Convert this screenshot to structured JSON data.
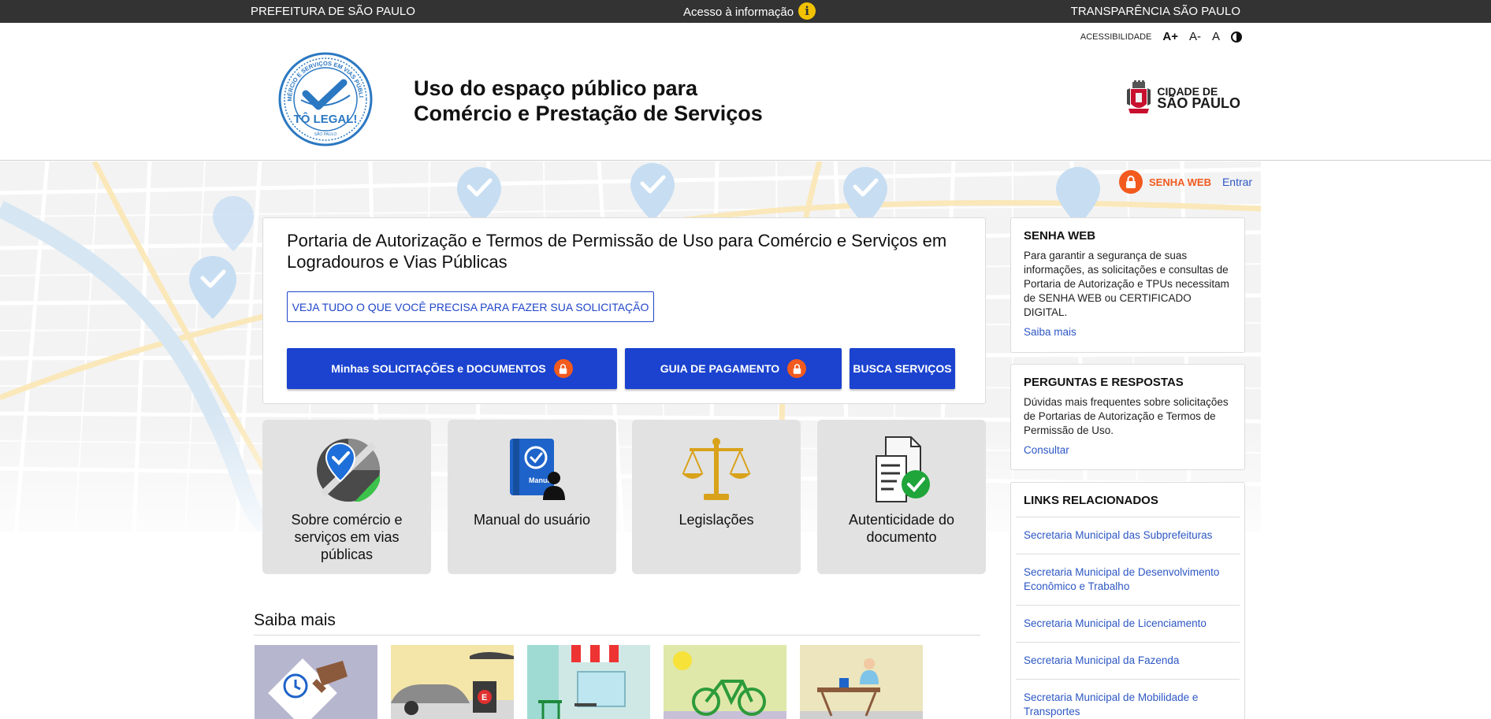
{
  "topbar": {
    "left": "PREFEITURA DE SÃO PAULO",
    "center": "Acesso à informação",
    "right": "TRANSPARÊNCIA SÃO PAULO"
  },
  "accessibility": {
    "label": "ACESSIBILIDADE",
    "increase": "A+",
    "decrease": "A-",
    "reset": "A"
  },
  "header": {
    "seal_text_top": "COMÉRCIO E SERVIÇOS EM VIAS PÚBLICAS",
    "seal_text_main": "TÔ LEGAL!",
    "seal_text_bottom": "SÃO PAULO",
    "title_line1": "Uso do espaço público para",
    "title_line2": "Comércio e Prestação de Serviços",
    "city_line1": "CIDADE DE",
    "city_line2": "SÃO PAULO"
  },
  "login": {
    "senha_label": "SENHA WEB",
    "entrar_label": "Entrar"
  },
  "main": {
    "heading": "Portaria de Autorização e Termos de Permissão de Uso para Comércio e Serviços em Logradouros e Vias Públicas",
    "outline_button": "VEJA TUDO O QUE VOCÊ PRECISA PARA FAZER SUA SOLICITAÇÃO",
    "btn_solicitacoes": "Minhas SOLICITAÇÕES e DOCUMENTOS",
    "btn_guia": "GUIA DE PAGAMENTO",
    "btn_busca": "BUSCA SERVIÇOS"
  },
  "tiles": [
    {
      "label": "Sobre comércio e serviços em vias públicas",
      "icon": "map-pin-check-icon"
    },
    {
      "label": "Manual do usuário",
      "icon": "manual-book-icon",
      "icon_text": "Manual"
    },
    {
      "label": "Legislações",
      "icon": "scales-icon"
    },
    {
      "label": "Autenticidade do documento",
      "icon": "document-check-icon"
    }
  ],
  "saiba_mais": {
    "title": "Saiba mais"
  },
  "sidebar": {
    "senha": {
      "title": "SENHA WEB",
      "text": "Para garantir a segurança de suas informações, as solicitações e consultas de Portaria de Autorização e TPUs necessitam de SENHA WEB ou CERTIFICADO DIGITAL.",
      "link": "Saiba mais"
    },
    "faq": {
      "title": "PERGUNTAS E RESPOSTAS",
      "text": "Dúvidas mais frequentes sobre solicitações de Portarias de Autorização e Termos de Permissão de Uso.",
      "link": "Consultar"
    },
    "links": {
      "title": "LINKS RELACIONADOS",
      "items": [
        "Secretaria Municipal das Subprefeituras",
        "Secretaria Municipal de Desenvolvimento Econômico e Trabalho",
        "Secretaria Municipal de Licenciamento",
        "Secretaria Municipal da Fazenda",
        "Secretaria Municipal de Mobilidade e Transportes"
      ]
    }
  },
  "colors": {
    "topbar": "#333333",
    "primary_blue": "#1b43cf",
    "link_blue": "#2d57c4",
    "lock_orange": "#f25a1e",
    "seal_blue": "#2b78c2",
    "tile_gray": "#e2e2e2"
  }
}
